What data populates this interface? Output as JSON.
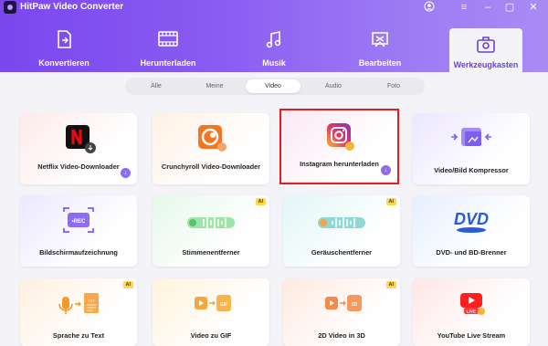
{
  "app": {
    "title": "HitPaw Video Converter"
  },
  "main_tabs": [
    {
      "label": "Konvertieren",
      "icon": "convert-icon"
    },
    {
      "label": "Herunterladen",
      "icon": "film-download-icon"
    },
    {
      "label": "Musik",
      "icon": "music-icon"
    },
    {
      "label": "Bearbeiten",
      "icon": "edit-icon"
    },
    {
      "label": "Werkzeugkasten",
      "icon": "toolbox-icon",
      "active": true
    }
  ],
  "sub_tabs": [
    {
      "label": "Alle"
    },
    {
      "label": "Meine"
    },
    {
      "label": "Video",
      "active": true
    },
    {
      "label": "Audio"
    },
    {
      "label": "Foto"
    }
  ],
  "tools": [
    {
      "label": "Netflix Video-Downloader",
      "icon": "netflix-icon",
      "download_badge": true
    },
    {
      "label": "Crunchyroll Video-Downloader",
      "icon": "crunchyroll-icon",
      "download_badge": false
    },
    {
      "label": "Instagram herunterladen",
      "icon": "instagram-icon",
      "download_badge": true,
      "highlighted": true
    },
    {
      "label": "Video/Bild Kompressor",
      "icon": "compress-icon"
    },
    {
      "label": "Bildschirmaufzeichnung",
      "icon": "screen-record-icon",
      "icon_text": "•REC"
    },
    {
      "label": "Stimmenentferner",
      "icon": "vocal-remover-icon",
      "ai": "AI"
    },
    {
      "label": "Geräuschentferner",
      "icon": "noise-remover-icon",
      "ai": "AI"
    },
    {
      "label": "DVD- und BD-Brenner",
      "icon": "dvd-icon",
      "icon_text": "DVD"
    },
    {
      "label": "Sprache zu Text",
      "icon": "speech-to-text-icon",
      "ai": "AI",
      "icon_text": "TXT"
    },
    {
      "label": "Video zu GIF",
      "icon": "video-to-gif-icon",
      "icon_text": "GIF"
    },
    {
      "label": "2D Video in 3D",
      "icon": "2d-to-3d-icon",
      "ai": "AI",
      "icon_text": "3D"
    },
    {
      "label": "YouTube Live Stream",
      "icon": "youtube-live-icon",
      "icon_text": "LIVE"
    }
  ],
  "colors": {
    "accent": "#7a47ee",
    "highlight": "#e02020",
    "ai_badge": "#ffd84a"
  }
}
